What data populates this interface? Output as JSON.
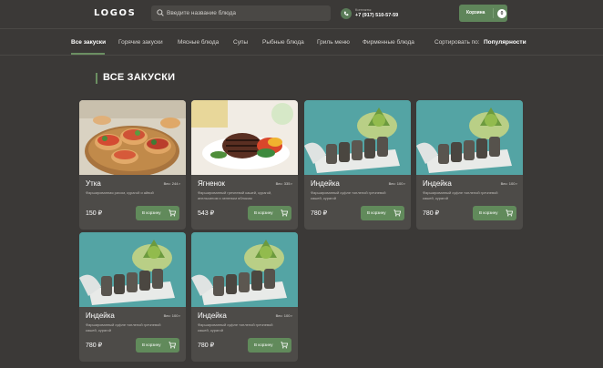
{
  "header": {
    "logo": "LOGOS",
    "search_placeholder": "Введите название блюда",
    "contacts_label": "Контакты:",
    "phone": "+7 (917) 510-57-59",
    "cart_label": "Корзина",
    "cart_count": "0"
  },
  "nav": {
    "items": [
      {
        "label": "Все закуски",
        "active": true
      },
      {
        "label": "Горячие закуски"
      },
      {
        "label": "Мясные блюда"
      },
      {
        "label": "Супы"
      },
      {
        "label": "Рыбные блюда"
      },
      {
        "label": "Гриль меню"
      },
      {
        "label": "Фирменные блюда"
      }
    ],
    "sort_label": "Сортировать по:",
    "sort_value": "Популярности"
  },
  "section_title": "ВСЕ ЗАКУСКИ",
  "products": [
    {
      "name": "Утка",
      "weight": "Вес: 244 г",
      "desc": "Фаршированная рисом, курагой и айвой",
      "price": "150 ₽",
      "button": "В корзину",
      "image": "bruschetta"
    },
    {
      "name": "Ягненок",
      "weight": "Вес: 335 г",
      "desc": "Фаршированный гречневой кашей, курагой, апельсином и зеленым яблоком",
      "price": "543 ₽",
      "button": "В корзину",
      "image": "steak"
    },
    {
      "name": "Индейка",
      "weight": "Вес: 100 г",
      "desc": "Фаршированный суфле топленой гречневой кашей, курагой",
      "price": "780 ₽",
      "button": "В корзину",
      "image": "fish"
    },
    {
      "name": "Индейка",
      "weight": "Вес: 100 г",
      "desc": "Фаршированный суфле топленой гречневой кашей, курагой",
      "price": "780 ₽",
      "button": "В корзину",
      "image": "fish"
    },
    {
      "name": "Индейка",
      "weight": "Вес: 100 г",
      "desc": "Фаршированный суфле топленой гречневой кашей, курагой",
      "price": "780 ₽",
      "button": "В корзину",
      "image": "fish"
    },
    {
      "name": "Индейка",
      "weight": "Вес: 100 г",
      "desc": "Фаршированный суфле топленой гречневой кашей, курагой",
      "price": "780 ₽",
      "button": "В корзину",
      "image": "fish"
    }
  ],
  "colors": {
    "background": "#3b3937",
    "card": "#4d4b48",
    "accent": "#618a5b"
  }
}
